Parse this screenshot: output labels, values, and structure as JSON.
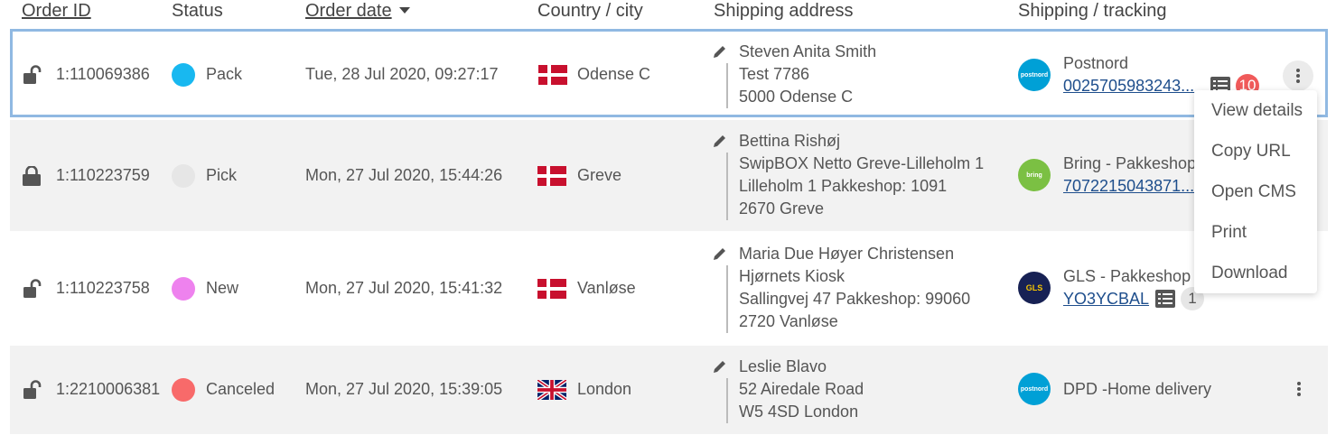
{
  "header": {
    "order_id": "Order ID",
    "status": "Status",
    "order_date": "Order date",
    "country": "Country / city",
    "address": "Shipping address",
    "shipping": "Shipping / tracking"
  },
  "rows": [
    {
      "order_id": "1:110069386",
      "locked": false,
      "status": "Pack",
      "status_color": "#18b8f0",
      "date": "Tue, 28 Jul 2020, 09:27:17",
      "country_flag": "dk",
      "city": "Odense C",
      "address_name": "Steven Anita Smith",
      "address_lines": [
        "Test 7786",
        "5000 Odense C"
      ],
      "carrier_logo": "postnord",
      "carrier": "Postnord",
      "tracking": "0025705983243...",
      "notes_count": "10"
    },
    {
      "order_id": "1:110223759",
      "locked": true,
      "status": "Pick",
      "status_color": "#e6e6e6",
      "date": "Mon, 27 Jul 2020, 15:44:26",
      "country_flag": "dk",
      "city": "Greve",
      "address_name": "Bettina Rishøj",
      "address_lines": [
        "SwipBOX Netto Greve-Lilleholm 1",
        "Lilleholm 1 Pakkeshop: 1091",
        "2670 Greve"
      ],
      "carrier_logo": "bring",
      "carrier": "Bring - Pakkeshop",
      "tracking": "7072215043871..."
    },
    {
      "order_id": "1:110223758",
      "locked": false,
      "status": "New",
      "status_color": "#ee82ee",
      "date": "Mon, 27 Jul 2020, 15:41:32",
      "country_flag": "dk",
      "city": "Vanløse",
      "address_name": "Maria Due Høyer Christensen",
      "address_lines": [
        "Hjørnets Kiosk",
        "Sallingvej 47 Pakkeshop: 99060",
        "2720 Vanløse"
      ],
      "carrier_logo": "gls",
      "carrier": "GLS - Pakkeshop",
      "tracking": "YO3YCBAL",
      "notes_count": "1"
    },
    {
      "order_id": "1:2210006381",
      "locked": false,
      "status": "Canceled",
      "status_color": "#f86a6a",
      "date": "Mon, 27 Jul 2020, 15:39:05",
      "country_flag": "uk",
      "city": "London",
      "address_name": "Leslie Blavo",
      "address_lines": [
        "52 Airedale Road",
        "W5 4SD London"
      ],
      "carrier_logo": "postnord",
      "carrier": "DPD -Home delivery"
    }
  ],
  "logos": {
    "postnord": "postnord",
    "bring": "bring",
    "gls": "GLS"
  },
  "menu": {
    "items": [
      "View details",
      "Copy URL",
      "Open CMS",
      "Print",
      "Download"
    ]
  },
  "colors": {
    "selected_border": "#90b9e2",
    "link": "#1e4e8c",
    "badge_red": "#f05a5a",
    "postnord": "#00a0d6",
    "bring": "#7bc043",
    "gls": "#172154"
  }
}
